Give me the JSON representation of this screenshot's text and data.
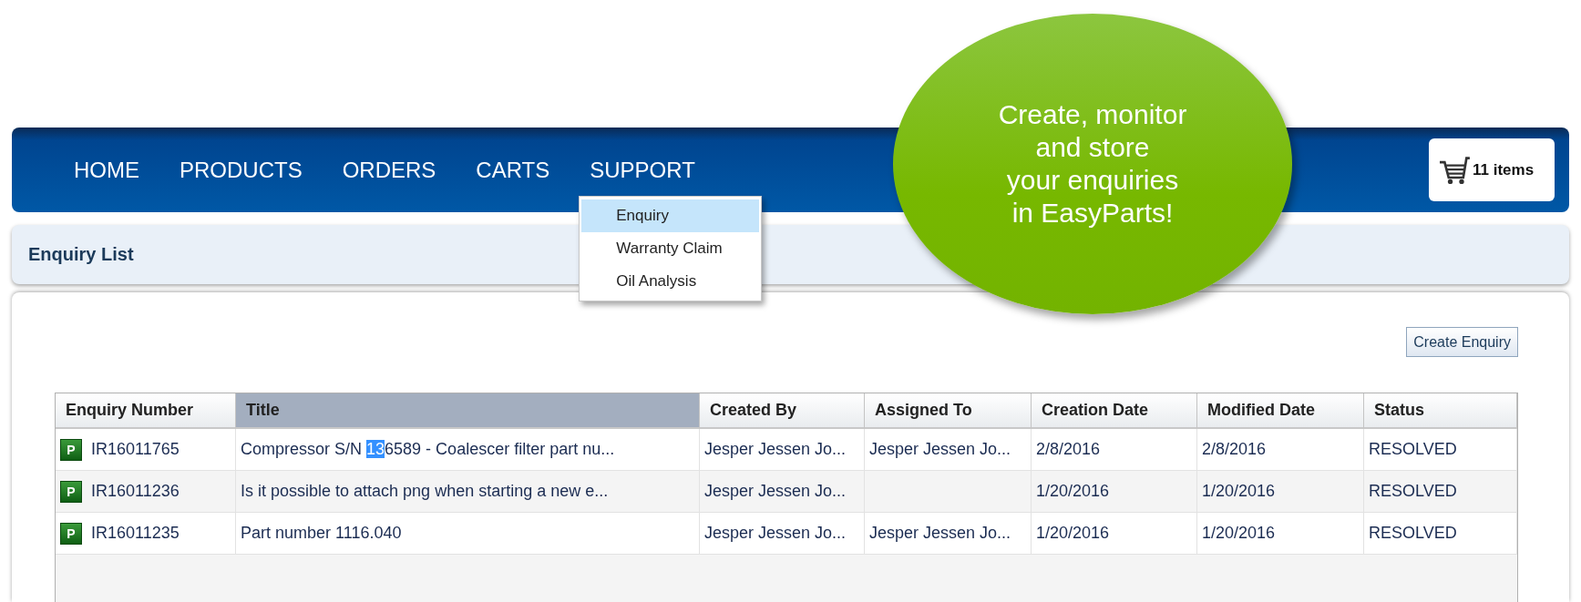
{
  "nav": {
    "items": [
      {
        "label": "HOME"
      },
      {
        "label": "PRODUCTS"
      },
      {
        "label": "ORDERS"
      },
      {
        "label": "CARTS"
      },
      {
        "label": "SUPPORT",
        "menu": [
          {
            "label": "Enquiry",
            "selected": true
          },
          {
            "label": "Warranty Claim",
            "selected": false
          },
          {
            "label": "Oil Analysis",
            "selected": false
          }
        ]
      }
    ],
    "cart": {
      "label": "11 items"
    }
  },
  "callout": {
    "lines": [
      "Create, monitor",
      "and store",
      "your enquiries",
      "in EasyParts!"
    ]
  },
  "page_title": "Enquiry List",
  "create_button": "Create Enquiry",
  "table": {
    "columns": [
      {
        "label": "Enquiry Number",
        "sorted": false
      },
      {
        "label": "Title",
        "sorted": true
      },
      {
        "label": "Created By",
        "sorted": false
      },
      {
        "label": "Assigned To",
        "sorted": false
      },
      {
        "label": "Creation Date",
        "sorted": false
      },
      {
        "label": "Modified Date",
        "sorted": false
      },
      {
        "label": "Status",
        "sorted": false
      }
    ],
    "rows": [
      {
        "badge": "P",
        "number": "IR16011765",
        "title_parts": [
          {
            "text": "Compressor S/N ",
            "selected": false
          },
          {
            "text": "13",
            "selected": true
          },
          {
            "text": "6589 - Coalescer filter part nu...",
            "selected": false
          }
        ],
        "created_by": "Jesper Jessen Jo...",
        "assigned_to": "Jesper Jessen Jo...",
        "creation_date": "2/8/2016",
        "modified_date": "2/8/2016",
        "status": "RESOLVED"
      },
      {
        "badge": "P",
        "number": "IR16011236",
        "title_parts": [
          {
            "text": "Is it possible to attach png when starting a new e...",
            "selected": false
          }
        ],
        "created_by": "Jesper Jessen Jo...",
        "creation_date": "1/20/2016",
        "modified_date": "1/20/2016",
        "status": "RESOLVED"
      },
      {
        "badge": "P",
        "number": "IR16011235",
        "title_parts": [
          {
            "text": "Part number 1116.040",
            "selected": false
          }
        ],
        "created_by": "Jesper Jessen Jo...",
        "assigned_to": "Jesper Jessen Jo...",
        "creation_date": "1/20/2016",
        "modified_date": "1/20/2016",
        "status": "RESOLVED"
      }
    ]
  }
}
